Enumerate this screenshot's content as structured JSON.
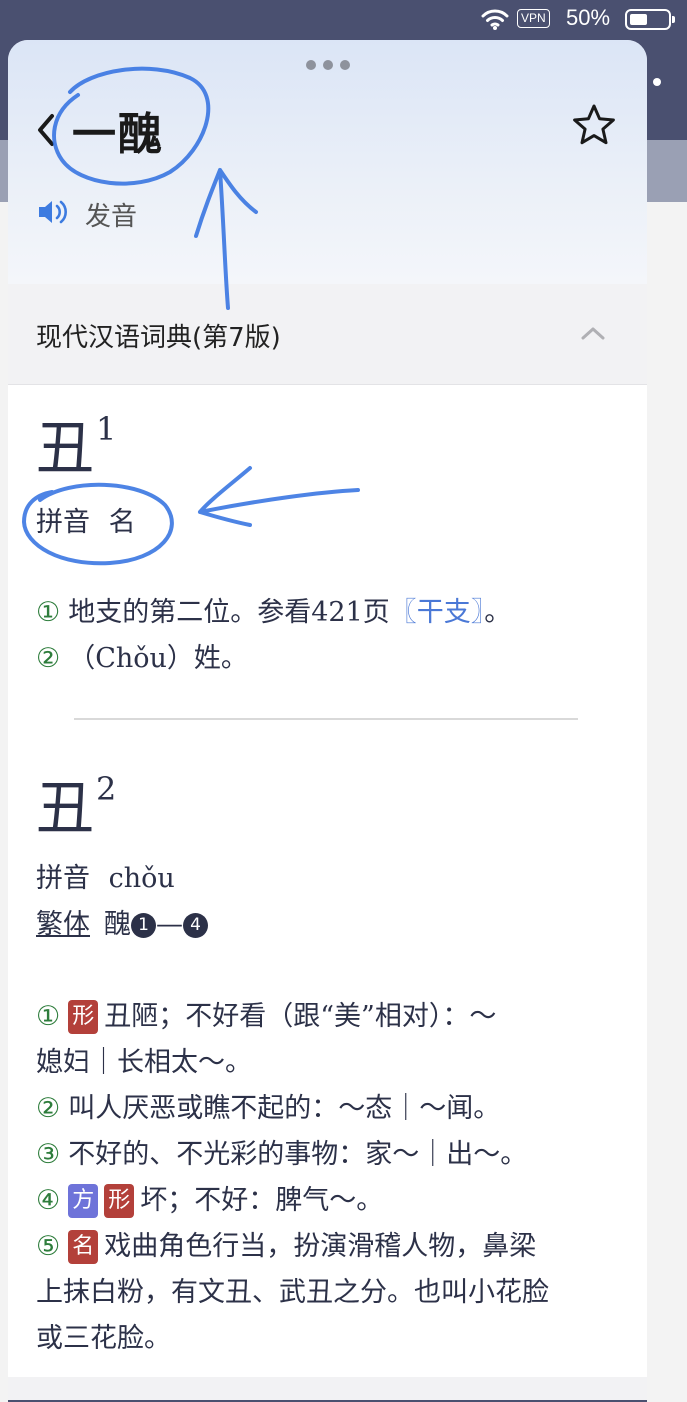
{
  "status_bar": {
    "vpn": "VPN",
    "battery_pct": "50%"
  },
  "header": {
    "title": "一醜",
    "pronounce_label": "发音"
  },
  "source": {
    "title": "现代汉语词典(第7版)"
  },
  "entry1": {
    "char": "丑",
    "sup": "1",
    "pinyin_label": "拼音",
    "pinyin_value": "名",
    "senses": [
      {
        "num": "①",
        "text": "地支的第二位。参看421页",
        "link": "〖干支〗",
        "tail": "。"
      },
      {
        "num": "②",
        "text": "（Chǒu）姓。"
      }
    ]
  },
  "entry2": {
    "char": "丑",
    "sup": "2",
    "pinyin_label": "拼音",
    "pinyin_value": "chǒu",
    "fanti_label": "繁体",
    "fanti_value": "醜",
    "fanti_from": "1",
    "fanti_dash": "—",
    "fanti_to": "4",
    "senses": [
      {
        "num": "①",
        "tags": [
          "形"
        ],
        "line1": "丑陋；不好看（跟“美”相对）：～",
        "line2": "媳妇｜长相太～。"
      },
      {
        "num": "②",
        "line1": "叫人厌恶或瞧不起的：～态｜～闻。"
      },
      {
        "num": "③",
        "line1": "不好的、不光彩的事物：家～｜出～。"
      },
      {
        "num": "④",
        "tags": [
          "方",
          "形"
        ],
        "line1": "坏；不好：脾气～。"
      },
      {
        "num": "⑤",
        "tags": [
          "名"
        ],
        "line1": "戏曲角色行当，扮演滑稽人物，鼻梁",
        "line2": "上抹白粉，有文丑、武丑之分。也叫小花脸",
        "line3": "或三花脸。"
      }
    ]
  },
  "colors": {
    "accent": "#4a78d6",
    "sense_num": "#2e7d3c",
    "tag_red": "#b3403a",
    "tag_purple": "#6e73d9",
    "annotation": "#2f6fe0"
  },
  "icons": [
    "wifi-icon",
    "battery-icon",
    "back-chevron-icon",
    "star-icon",
    "speaker-icon",
    "chevron-up-icon"
  ]
}
